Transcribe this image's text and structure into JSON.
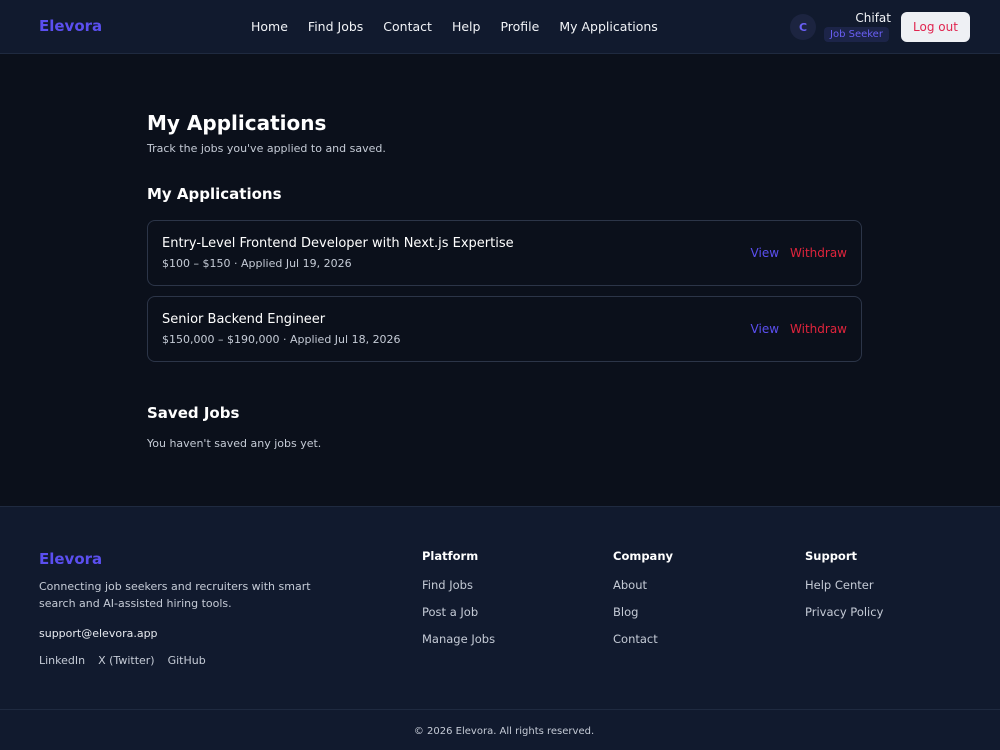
{
  "header": {
    "brand": "Elevora",
    "nav": [
      "Home",
      "Find Jobs",
      "Contact",
      "Help",
      "Profile",
      "My Applications"
    ],
    "avatar_initial": "C",
    "user_name": "Chifat",
    "role": "Job Seeker",
    "logout_label": "Log out"
  },
  "main": {
    "title": "My Applications",
    "subtitle": "Track the jobs you've applied to and saved.",
    "applications_heading": "My Applications",
    "applications": [
      {
        "title": "Entry-Level Frontend Developer with Next.js Expertise",
        "meta": "$100 – $150 · Applied Jul 19, 2026",
        "view": "View",
        "withdraw": "Withdraw"
      },
      {
        "title": "Senior Backend Engineer",
        "meta": "$150,000 – $190,000 · Applied Jul 18, 2026",
        "view": "View",
        "withdraw": "Withdraw"
      }
    ],
    "saved_heading": "Saved Jobs",
    "saved_empty": "You haven't saved any jobs yet."
  },
  "footer": {
    "brand": "Elevora",
    "tagline": "Connecting job seekers and recruiters with smart search and AI-assisted hiring tools.",
    "email": "support@elevora.app",
    "socials": [
      "LinkedIn",
      "X (Twitter)",
      "GitHub"
    ],
    "columns": [
      {
        "heading": "Platform",
        "links": [
          "Find Jobs",
          "Post a Job",
          "Manage Jobs"
        ]
      },
      {
        "heading": "Company",
        "links": [
          "About",
          "Blog",
          "Contact"
        ]
      },
      {
        "heading": "Support",
        "links": [
          "Help Center",
          "Privacy Policy"
        ]
      }
    ],
    "copyright": "© 2026 Elevora. All rights reserved."
  },
  "colors": {
    "accent": "#5b4ff0",
    "danger": "#e0243c",
    "background": "#0b101b",
    "surface": "#111a2e"
  }
}
